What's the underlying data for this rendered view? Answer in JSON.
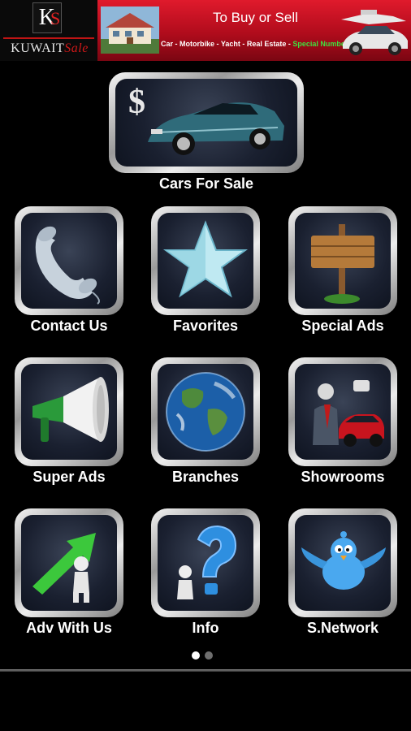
{
  "header": {
    "logo_mark_k": "K",
    "logo_mark_s": "S",
    "logo_text_main": "KUWAIT",
    "logo_text_accent": "Sale",
    "banner_title": "To Buy or Sell",
    "banner_subtitle": "Car - Motorbike - Yacht - Real Estate - ",
    "banner_highlight": "Special Number"
  },
  "featured": {
    "label": "Cars For Sale",
    "icon": "sports-car-dollar-icon"
  },
  "grid": [
    {
      "label": "Contact Us",
      "icon": "telephone-icon"
    },
    {
      "label": "Favorites",
      "icon": "star-icon"
    },
    {
      "label": "Special Ads",
      "icon": "signpost-icon"
    },
    {
      "label": "Super Ads",
      "icon": "megaphone-icon"
    },
    {
      "label": "Branches",
      "icon": "globe-icon"
    },
    {
      "label": "Showrooms",
      "icon": "dealer-car-icon"
    },
    {
      "label": "Adv With Us",
      "icon": "growth-arrow-icon"
    },
    {
      "label": "Info",
      "icon": "question-mark-icon"
    },
    {
      "label": "S.Network",
      "icon": "twitter-bird-icon"
    }
  ],
  "pager": {
    "pages": 2,
    "current": 1
  },
  "colors": {
    "background": "#000000",
    "banner_red": "#d0142a",
    "accent_green": "#3fe03f",
    "tile_inner": "#1a2030"
  }
}
